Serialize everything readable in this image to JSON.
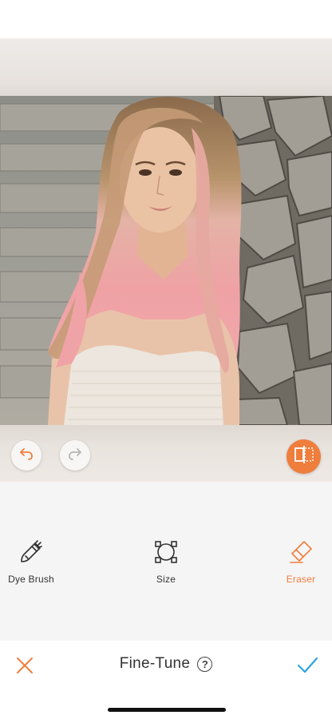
{
  "screen": {
    "title": "Fine-Tune",
    "help_symbol": "?"
  },
  "toolbar": {
    "tools": [
      {
        "label": "Dye Brush",
        "icon": "dye-brush-icon",
        "active": false
      },
      {
        "label": "Size",
        "icon": "size-icon",
        "active": false
      },
      {
        "label": "Eraser",
        "icon": "eraser-icon",
        "active": true
      }
    ]
  },
  "actions": {
    "undo_icon": "undo-icon",
    "redo_icon": "redo-icon",
    "compare_icon": "compare-icon",
    "cancel_icon": "close-icon",
    "confirm_icon": "checkmark-icon"
  },
  "colors": {
    "accent": "#ef7d3c",
    "confirm": "#29a6d9",
    "text": "#333333"
  }
}
